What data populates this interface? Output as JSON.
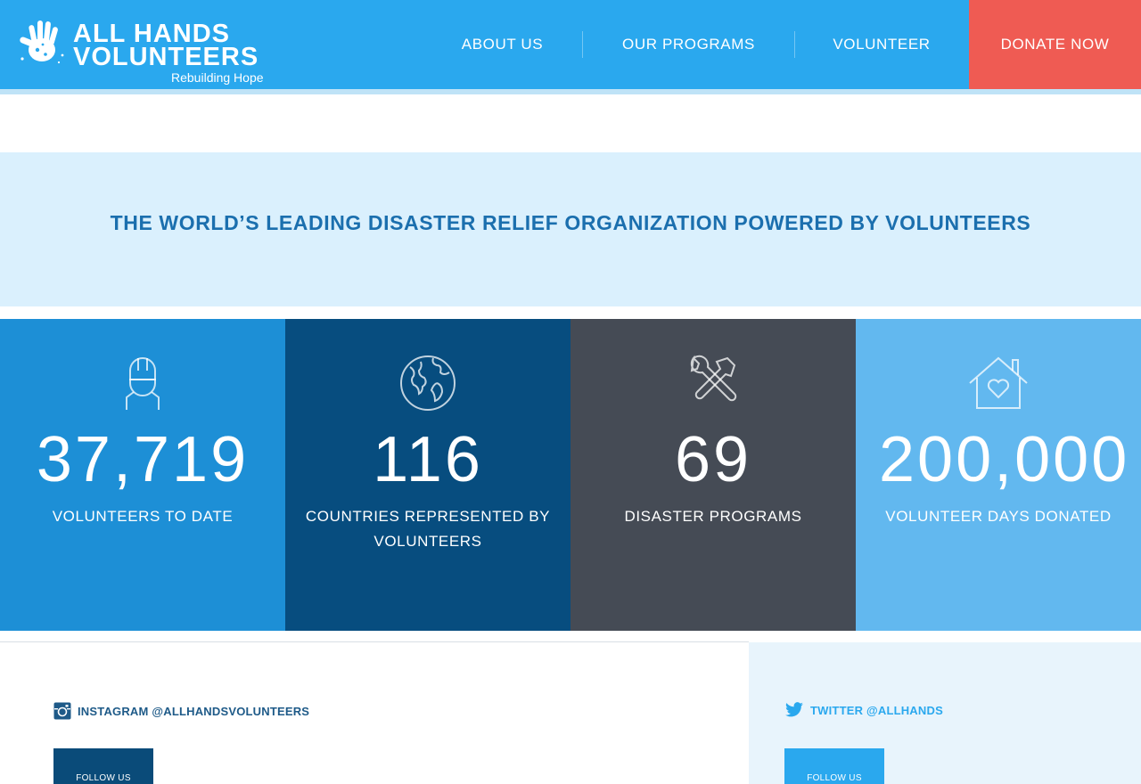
{
  "header": {
    "logo": {
      "line1": "ALL HANDS",
      "line2": "VOLUNTEERS",
      "tagline": "Rebuilding Hope"
    },
    "nav": [
      {
        "label": "ABOUT US"
      },
      {
        "label": "OUR PROGRAMS"
      },
      {
        "label": "VOLUNTEER"
      }
    ],
    "donate_label": "DONATE NOW"
  },
  "colors": {
    "header_blue": "#2aa8ee",
    "donate_red": "#ef5b53",
    "tagline_band": "#daf0fd",
    "tagline_text": "#1b6fae"
  },
  "tagline": "THE WORLD’S LEADING DISASTER RELIEF ORGANIZATION POWERED BY VOLUNTEERS",
  "stats": [
    {
      "icon": "hard-hat-worker-icon",
      "number": "37,719",
      "label": "VOLUNTEERS TO DATE",
      "color": "#1d8fd6"
    },
    {
      "icon": "globe-icon",
      "number": "116",
      "label": "COUNTRIES REPRESENTED BY VOLUNTEERS",
      "color": "#074d7f"
    },
    {
      "icon": "wrench-hammer-icon",
      "number": "69",
      "label": "DISASTER PROGRAMS",
      "color": "#454b55"
    },
    {
      "icon": "house-heart-icon",
      "number": "200,000",
      "label": "VOLUNTEER DAYS DONATED",
      "color": "#62b8ef"
    }
  ],
  "social": {
    "instagram": {
      "icon": "instagram-icon",
      "label": "INSTAGRAM @ALLHANDSVOLUNTEERS",
      "button": "FOLLOW US"
    },
    "twitter": {
      "icon": "twitter-icon",
      "label": "TWITTER @ALLHANDS",
      "button": "FOLLOW US"
    }
  }
}
